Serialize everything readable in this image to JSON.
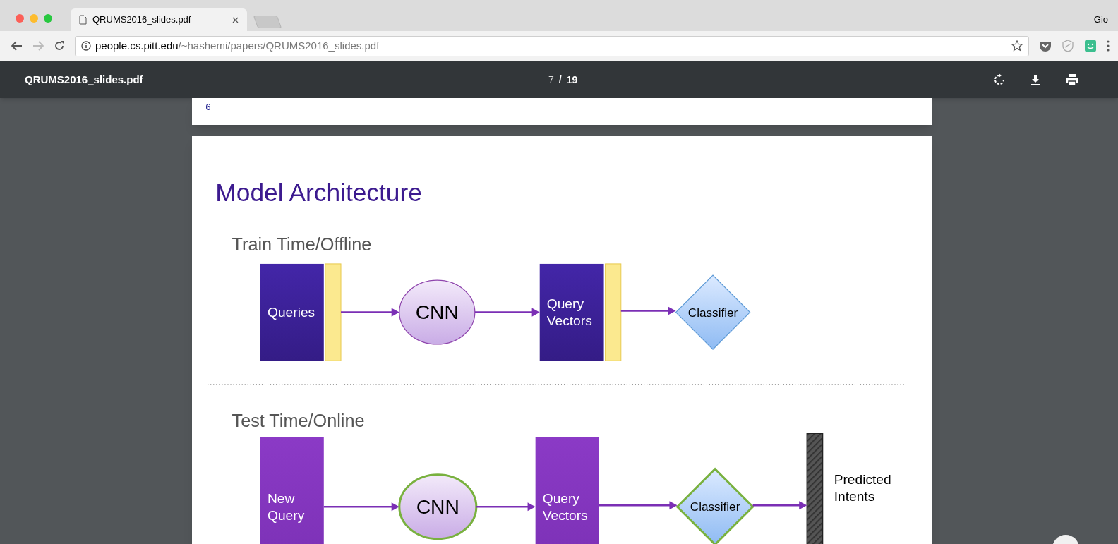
{
  "browser": {
    "tab_title": "QRUMS2016_slides.pdf",
    "profile": "Gio",
    "url_host": "people.cs.pitt.edu",
    "url_path": "/~hashemi/papers/QRUMS2016_slides.pdf"
  },
  "pdf_toolbar": {
    "title": "QRUMS2016_slides.pdf",
    "current_page": "7",
    "separator": "/",
    "total_pages": "19"
  },
  "previous_page": {
    "page_number": "6"
  },
  "slide": {
    "title": "Model Architecture",
    "sections": [
      {
        "kind": "train",
        "heading": "Train Time/Offline",
        "nodes": [
          {
            "kind": "box",
            "lines": [
              "Queries"
            ]
          },
          {
            "kind": "ellipse",
            "lines": [
              "CNN"
            ]
          },
          {
            "kind": "box",
            "lines": [
              "Query",
              "Vectors"
            ]
          },
          {
            "kind": "diamond",
            "lines": [
              "Classifier"
            ]
          }
        ]
      },
      {
        "kind": "test",
        "heading": "Test Time/Online",
        "nodes": [
          {
            "kind": "box",
            "lines": [
              "New",
              "Query"
            ]
          },
          {
            "kind": "ellipse",
            "lines": [
              "CNN"
            ]
          },
          {
            "kind": "box",
            "lines": [
              "Query",
              "Vectors"
            ]
          },
          {
            "kind": "diamond",
            "lines": [
              "Classifier"
            ]
          },
          {
            "kind": "bar",
            "lines": [
              "Predicted",
              "Intents"
            ]
          }
        ]
      }
    ]
  }
}
